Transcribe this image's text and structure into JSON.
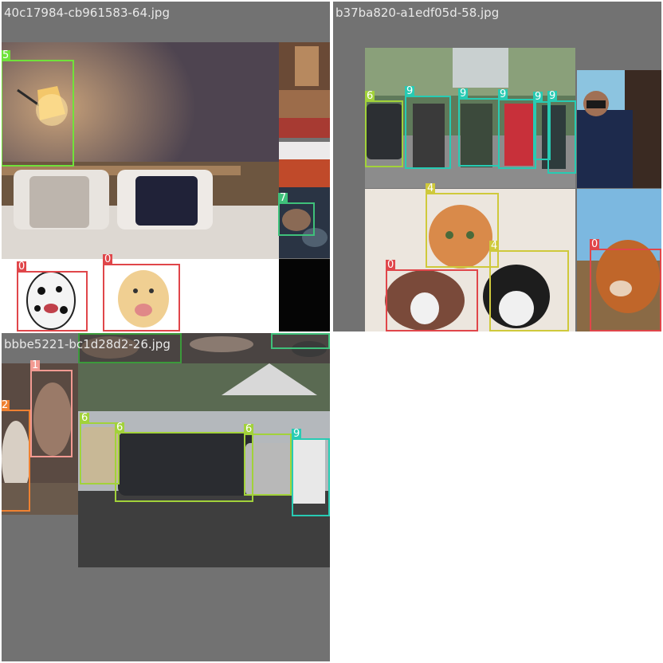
{
  "tiles": {
    "t1": {
      "filename": "40c17984-cb961583-64.jpg"
    },
    "t2": {
      "filename": "b37ba820-a1edf05d-58.jpg"
    },
    "t3": {
      "filename": "bbbe5221-bc1d28d2-26.jpg"
    }
  },
  "labels": {
    "l0": "0",
    "l1": "1",
    "l2": "2",
    "l4": "4",
    "l5": "5",
    "l6": "6",
    "l7": "7",
    "l8": "8",
    "l9": "9"
  },
  "class_colors": {
    "0": "#e0464a",
    "1": "#f29a92",
    "2": "#ef8132",
    "4": "#cfc93b",
    "5": "#70e23a",
    "6": "#a2d23a",
    "7": "#3fc07a",
    "8": "#3b9a3b",
    "9": "#27cbb3"
  }
}
